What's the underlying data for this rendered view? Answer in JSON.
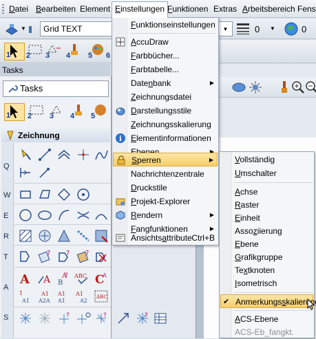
{
  "menubar": {
    "items": [
      {
        "label": "Datei",
        "mn": "D",
        "rest": "atei"
      },
      {
        "label": "Bearbeiten",
        "mn": "B",
        "rest": "earbeiten"
      },
      {
        "label": "Element",
        "mn": "",
        "rest": "Element"
      },
      {
        "label": "Einstellungen",
        "mn": "E",
        "rest": "instellungen"
      },
      {
        "label": "Funktionen",
        "mn": "F",
        "rest": "unktionen"
      },
      {
        "label": "Extras",
        "mn": "",
        "rest": "Extras"
      },
      {
        "label": "Arbeitsbereich",
        "mn": "A",
        "rest": "rbeitsbereich"
      },
      {
        "label": "Fenster",
        "mn": "",
        "rest": "Fenste"
      }
    ]
  },
  "toolbar1": {
    "text_style": "Grid TEXT",
    "weight_value": "0",
    "level_value": "0"
  },
  "toolbar2": {
    "select_tools": [
      "1",
      "2",
      "3",
      "4",
      "5",
      "6"
    ]
  },
  "tasks": {
    "header": "Tasks",
    "combo": "Tasks",
    "section": "Zeichnung",
    "row_labels": [
      "Q",
      "W",
      "E",
      "R",
      "T",
      "A",
      "S"
    ]
  },
  "einstellungen_menu": {
    "items": [
      {
        "label": "Funktionseinstellungen",
        "pre": "",
        "mn": "F",
        "post": "unktionseinstellungen",
        "icon": "",
        "submenu": false
      },
      {
        "label": "AccuDraw",
        "pre": "",
        "mn": "A",
        "post": "ccuDraw",
        "icon": "accudraw-icon",
        "submenu": false
      },
      {
        "label": "Farbbücher...",
        "pre": "",
        "mn": "F",
        "post": "arbbücher...",
        "icon": "",
        "submenu": false
      },
      {
        "label": "Farbtabelle...",
        "pre": "",
        "mn": "F",
        "post": "arbtabelle...",
        "icon": "",
        "submenu": false
      },
      {
        "label": "Datenbank",
        "pre": "Date",
        "mn": "n",
        "post": "bank",
        "icon": "",
        "submenu": true
      },
      {
        "label": "Zeichnungsdatei",
        "pre": "",
        "mn": "Z",
        "post": "eichnungsdatei",
        "icon": "",
        "submenu": false
      },
      {
        "label": "Darstellungsstile",
        "pre": "",
        "mn": "D",
        "post": "arstellungsstile",
        "icon": "display-styles-icon",
        "submenu": false
      },
      {
        "label": "Zeichnungsskalierung",
        "pre": "",
        "mn": "Z",
        "post": "eichnungsskalierung",
        "icon": "",
        "submenu": false
      },
      {
        "label": "Elementinformationen",
        "pre": "",
        "mn": "E",
        "post": "lementinformationen",
        "icon": "info-icon",
        "submenu": false
      },
      {
        "label": "Ebenen",
        "pre": "",
        "mn": "E",
        "post": "benen",
        "icon": "",
        "submenu": true
      },
      {
        "label": "Sperren",
        "pre": "",
        "mn": "S",
        "post": "perren",
        "icon": "lock-icon",
        "submenu": true,
        "highlighted": true
      },
      {
        "label": "Nachrichtenzentrale",
        "pre": "",
        "mn": "",
        "post": "Nachrichtenzentrale",
        "icon": "",
        "submenu": false
      },
      {
        "label": "Druckstile",
        "pre": "",
        "mn": "D",
        "post": "ruckstile",
        "icon": "",
        "submenu": false
      },
      {
        "label": "Projekt-Explorer",
        "pre": "",
        "mn": "P",
        "post": "rojekt-Explorer",
        "icon": "project-explorer-icon",
        "submenu": false
      },
      {
        "label": "Rendern",
        "pre": "",
        "mn": "R",
        "post": "endern",
        "icon": "render-icon",
        "submenu": true
      },
      {
        "label": "Fangfunktionen",
        "pre": "",
        "mn": "F",
        "post": "angfunktionen",
        "icon": "",
        "submenu": true
      },
      {
        "label": "Ansichtsattribute",
        "pre": "Ansichts",
        "mn": "a",
        "post": "ttribute",
        "icon": "view-attributes-icon",
        "submenu": false,
        "shortcut": "Ctrl+B"
      }
    ]
  },
  "sperren_menu": {
    "items": [
      {
        "label": "Vollständig",
        "pre": "",
        "mn": "V",
        "post": "ollständig"
      },
      {
        "label": "Umschalter",
        "pre": "",
        "mn": "U",
        "post": "mschalter"
      },
      {
        "label": "Achse",
        "pre": "",
        "mn": "A",
        "post": "chse"
      },
      {
        "label": "Raster",
        "pre": "",
        "mn": "R",
        "post": "aster"
      },
      {
        "label": "Einheit",
        "pre": "",
        "mn": "E",
        "post": "inheit"
      },
      {
        "label": "Assoziierung",
        "pre": "Asso",
        "mn": "z",
        "post": "iierung"
      },
      {
        "label": "Ebene",
        "pre": "",
        "mn": "E",
        "post": "bene"
      },
      {
        "label": "Grafikgruppe",
        "pre": "",
        "mn": "G",
        "post": "rafikgruppe"
      },
      {
        "label": "Textknoten",
        "pre": "Te",
        "mn": "x",
        "post": "tknoten"
      },
      {
        "label": "Isometrisch",
        "pre": "",
        "mn": "I",
        "post": "sometrisch"
      },
      {
        "label": "Anmerkungsskalierung",
        "pre": "Anmerkungs",
        "mn": "s",
        "post": "kalierung",
        "checked": true,
        "highlighted": true
      },
      {
        "label": "ACS-Ebene",
        "pre": "",
        "mn": "A",
        "post": "CS-Ebene"
      },
      {
        "label": "ACS-Eb_fangkt.",
        "pre": "",
        "mn": "",
        "post": "ACS-Eb_fangkt.",
        "disabled": true
      }
    ]
  }
}
